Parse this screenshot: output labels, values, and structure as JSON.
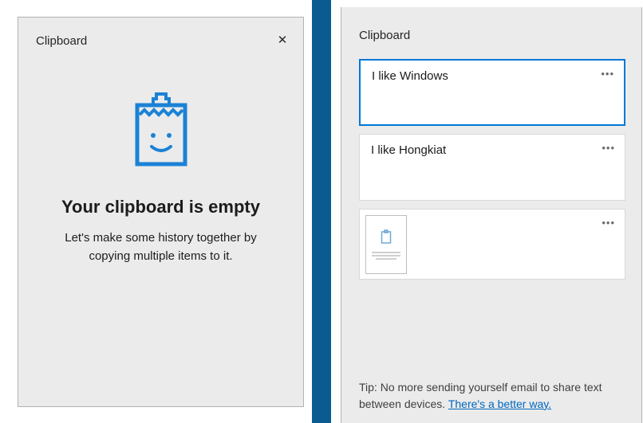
{
  "left": {
    "title": "Clipboard",
    "empty_heading": "Your clipboard is empty",
    "empty_sub": "Let's make some history together by copying multiple items to it."
  },
  "right": {
    "title": "Clipboard",
    "items": [
      {
        "type": "text",
        "text": "I like Windows",
        "selected": true
      },
      {
        "type": "text",
        "text": "I like Hongkiat",
        "selected": false
      },
      {
        "type": "image",
        "selected": false
      }
    ],
    "tip_text": "Tip: No more sending yourself email to share text between devices.  ",
    "tip_link": "There's a better way."
  },
  "colors": {
    "accent": "#0078d7",
    "divider": "#0a5b8f"
  }
}
